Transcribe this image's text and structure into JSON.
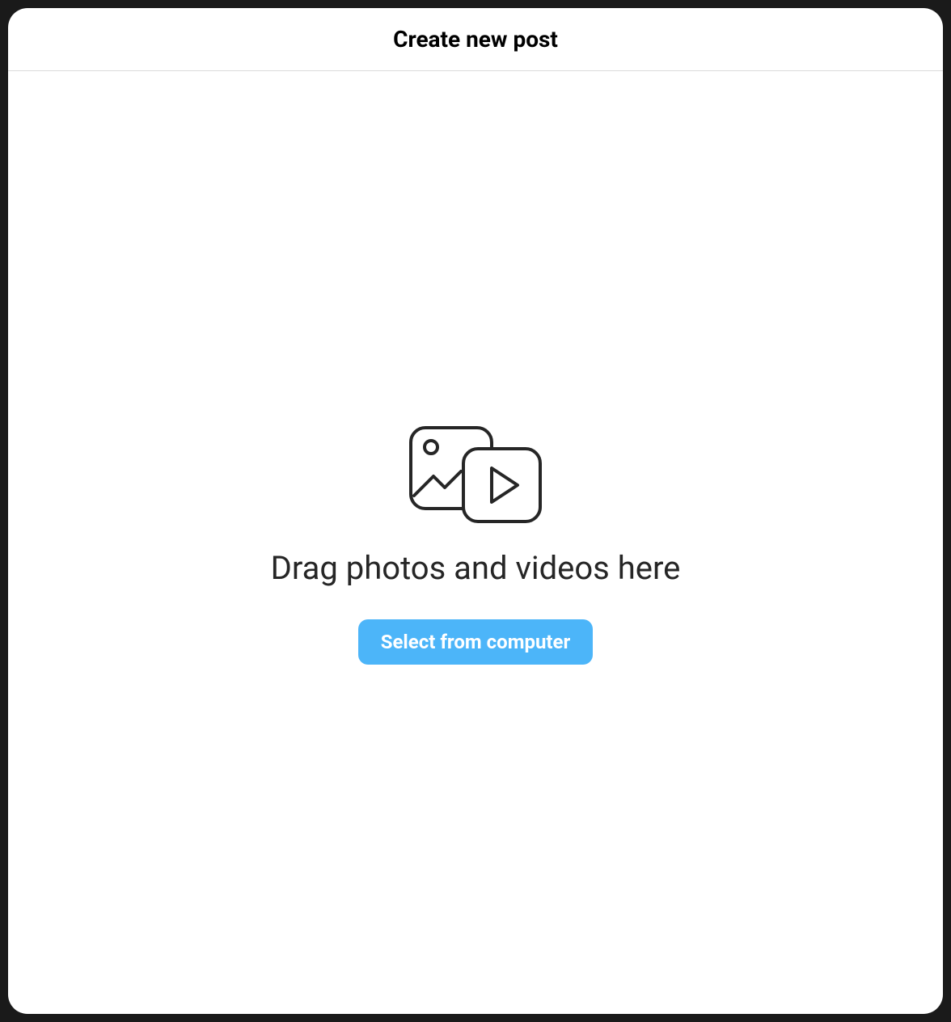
{
  "modal": {
    "title": "Create new post",
    "body": {
      "drag_text": "Drag photos and videos here",
      "select_button_label": "Select from computer"
    }
  }
}
